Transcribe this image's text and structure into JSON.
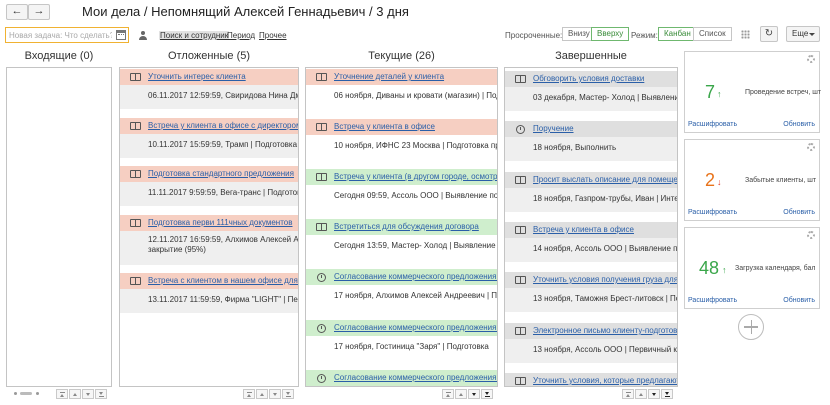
{
  "header": {
    "back_label": "←",
    "forward_label": "→",
    "title": "Мои дела / Непомнящий Алексей Геннадьевич / 3 дня"
  },
  "toolbar": {
    "new_task_placeholder": "Новая задача: Что сделать?",
    "search_label": "Поиск и сотрудник",
    "period_label": "Период",
    "other_label": "Прочее",
    "overdue_label": "Просроченные:",
    "overdue_options": [
      "Внизу",
      "Вверху"
    ],
    "mode_label": "Режим:",
    "mode_options": [
      "Канбан",
      "Список"
    ],
    "more_label": "Еще",
    "refresh_label": "↻"
  },
  "columns": {
    "incoming": {
      "title": "Входящие (0)"
    },
    "postponed": {
      "title": "Отложенные (5)",
      "cards": [
        {
          "title": "Уточнить интерес клиента",
          "detail": "06.11.2017 12:59:59, Свиридова Нина Дмитр"
        },
        {
          "title": "Встреча у клиента в офисе с директором",
          "detail": "10.11.2017 15:59:59, Трамп | Подготовка пре"
        },
        {
          "title": "Подготовка стандартного предложения",
          "detail": "11.11.2017 9:59:59, Вега-транс | Подготовка"
        },
        {
          "title": "Подготовка перви 111чных документов",
          "detail": "12.11.2017 16:59:59, Алхимов Алексей Андр",
          "detail2": "закрытие (95%)"
        },
        {
          "title": "Встреча с клиентом в нашем офисе для подг",
          "detail": "13.11.2017 11:59:59, Фирма \"LIGHT\" | Первич"
        }
      ]
    },
    "current": {
      "title": "Текущие (26)",
      "cards": [
        {
          "title": "Уточнение деталей у клиента",
          "detail": "06 ноября, Диваны и кровати (магазин) | Подгот"
        },
        {
          "title": "Встреча у клиента в офисе",
          "detail": "10 ноября, ИФНС 23 Москва | Подготовка пре"
        },
        {
          "title": "Встреча у клиента (в другом городе, осмотр б",
          "detail": "Сегодня 09:59, Ассоль ООО | Выявление потреб"
        },
        {
          "title": "Встретиться для обсуждения договора",
          "detail": "Сегодня 13:59, Мастер- Холод | Выявление потр"
        },
        {
          "title": "Согласование коммерческого предложения  (",
          "detail": "17 ноября, Алхимов Алексей Андреевич | Подгот"
        },
        {
          "title": "Согласование коммерческого предложения  (",
          "detail": "17 ноября, Гостиница \"Заря\" | Подготовка"
        },
        {
          "title": "Согласование коммерческого предложения  (",
          "detail": ""
        }
      ]
    },
    "completed": {
      "title": "Завершенные",
      "cards": [
        {
          "title": "Обговорить условия доставки",
          "detail": "03 декабря, Мастер- Холод | Выявление пот"
        },
        {
          "title": "Поручение",
          "detail": "18 ноября, Выполнить"
        },
        {
          "title": "Просит выслать описание для помещен",
          "detail": "18 ноября, Газпром-трубы, Иван | Интерес"
        },
        {
          "title": "Встреча у клиента в офисе",
          "detail": "14 ноября, Ассоль ООО | Выявление потр"
        },
        {
          "title": "Уточнить условия получения груза для к",
          "detail": "13 ноября, Таможня Брест-литовск | Подгот"
        },
        {
          "title": "Электронное письмо клиенту-подготови",
          "detail": "13 ноября, Ассоль ООО | Первичный конта"
        },
        {
          "title": "Уточнить условия, которые предлагают",
          "detail": ""
        }
      ]
    }
  },
  "widgets": [
    {
      "value": "7",
      "arrow": "↑",
      "caption": "Проведение встреч, шт",
      "detail_link": "Расшифровать",
      "refresh_link": "Обновить",
      "color": "#3aa64a"
    },
    {
      "value": "2",
      "arrow": "↓",
      "caption": "Забытые клиенты, шт",
      "detail_link": "Расшифровать",
      "refresh_link": "Обновить",
      "color": "#e8731a"
    },
    {
      "value": "48",
      "arrow": "↑",
      "caption": "Загрузка календаря, бал",
      "detail_link": "Расшифровать",
      "refresh_link": "Обновить",
      "color": "#3aa64a"
    }
  ]
}
